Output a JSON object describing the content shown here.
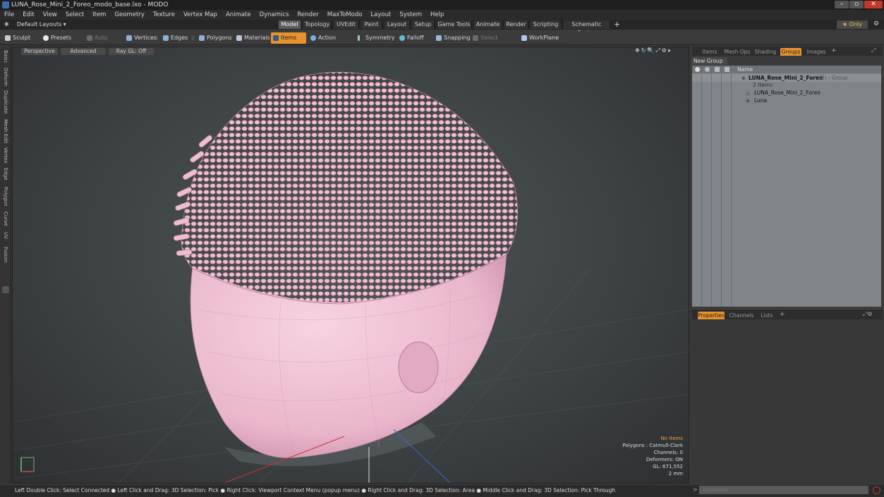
{
  "window": {
    "title": "LUNA_Rose_Mini_2_Foreo_modo_base.lxo - MODO"
  },
  "menu": [
    "File",
    "Edit",
    "View",
    "Select",
    "Item",
    "Geometry",
    "Texture",
    "Vertex Map",
    "Animate",
    "Dynamics",
    "Render",
    "MaxToModo",
    "Layout",
    "System",
    "Help"
  ],
  "layout": {
    "selector": "Default Layouts ▾",
    "tabs": [
      "Model",
      "Topology",
      "UVEdit",
      "Paint",
      "Layout",
      "Setup",
      "Game Tools",
      "Animate",
      "Render",
      "Scripting",
      "Schematic Fusion"
    ],
    "active_tab": "Model",
    "only_label": "★  Only"
  },
  "toolbar": {
    "sculpt": "Sculpt",
    "presets": "Presets",
    "presets_key": "F6",
    "auto_select": "Auto Select",
    "vertices": "Vertices",
    "vertices_key": "1",
    "edges": "Edges",
    "edges_key": "2",
    "polygons": "Polygons",
    "materials": "Materials",
    "items": "Items",
    "action_center": "Action Center",
    "symmetry": "Symmetry",
    "falloff": "Falloff",
    "snapping": "Snapping",
    "select_through": "Select Through",
    "workplane": "WorkPlane"
  },
  "left_tabs": [
    "Basic",
    "Deform",
    "Duplicate",
    "Mesh Edit",
    "Vertex",
    "Edge",
    "Polygon",
    "Curve",
    "UV",
    "Fusion"
  ],
  "viewport": {
    "perspective": "Perspective",
    "advanced": "Advanced",
    "raygl": "Ray GL: Off",
    "hud": {
      "no_items": "No Items",
      "polygons": "Polygons : Catmull-Clark",
      "channels": "Channels: 0",
      "deformers": "Deformers: ON",
      "gl": "GL: 671,552",
      "scale": "2 mm"
    },
    "colors": {
      "model": "#f0bcd2",
      "bristle": "#e9a9c4"
    }
  },
  "items_panel": {
    "tabs": [
      "Items",
      "Mesh Ops",
      "Shading",
      "Groups",
      "Images"
    ],
    "active_tab": "Groups",
    "new_group": "New Group",
    "name_header": "Name",
    "group_name": "LUNA_Rose_Mini_2_Foreo",
    "group_suffix": "(2) : Group",
    "group_count": "2 Items",
    "children": [
      "LUNA_Rose_Mini_2_Foreo",
      "Luna"
    ]
  },
  "props_panel": {
    "tabs": [
      "Properties",
      "Channels",
      "Lists"
    ],
    "active_tab": "Properties"
  },
  "status": {
    "text": "Left Double Click: Select Connected ● Left Click and Drag: 3D Selection: Pick ● Right Click: Viewport Context Menu (popup menu) ● Right Click and Drag: 3D Selection: Area ● Middle Click and Drag: 3D Selection: Pick Through"
  },
  "command": {
    "placeholder": "Command"
  }
}
